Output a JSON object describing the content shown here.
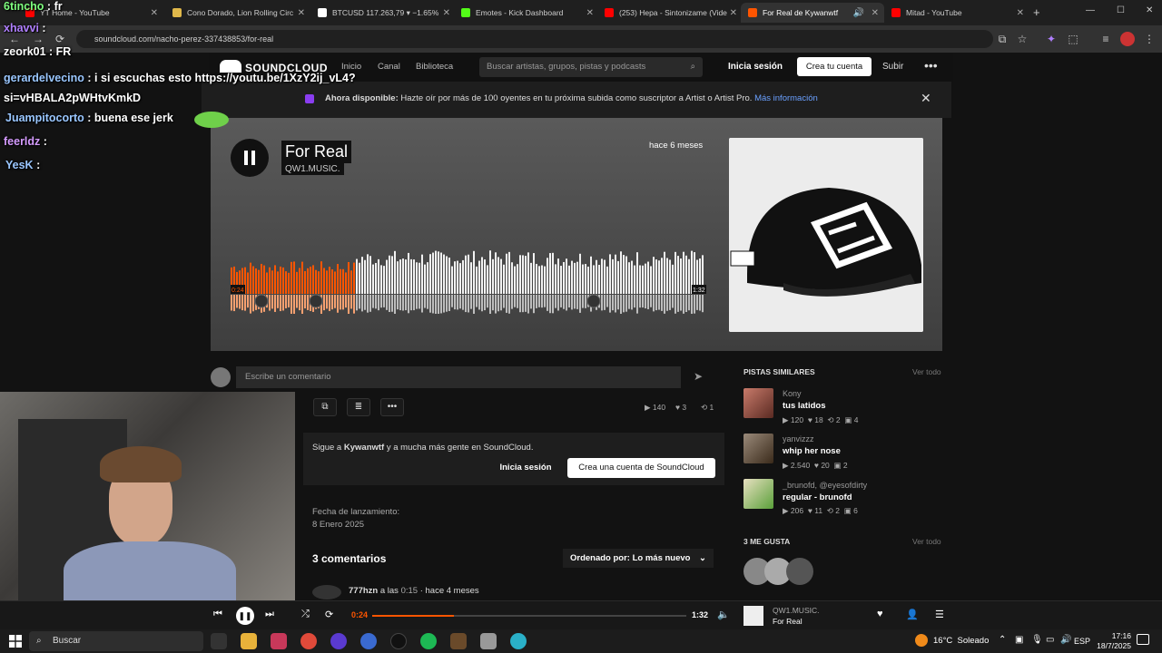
{
  "browser": {
    "tabs": [
      {
        "label": "YT Home - YouTube",
        "color": "#ff0000",
        "active": false
      },
      {
        "label": "Cono Dorado, Lion Rolling Circ",
        "color": "#e0b84a",
        "active": false
      },
      {
        "label": "BTCUSD 117.263,79 ▾ −1.65%",
        "color": "#ffffff",
        "active": false
      },
      {
        "label": "Emotes - Kick Dashboard",
        "color": "#53fc18",
        "active": false
      },
      {
        "label": "(253) Hepa - Sintonizame (Vide",
        "color": "#ff0000",
        "active": false
      },
      {
        "label": "For Real de Kywanwtf",
        "color": "#ff5500",
        "active": true
      },
      {
        "label": "Mitad - YouTube",
        "color": "#ff0000",
        "active": false
      }
    ],
    "url": "soundcloud.com/nacho-perez-337438853/for-real"
  },
  "soundcloud": {
    "logo": "SOUNDCLOUD",
    "nav": [
      "Inicio",
      "Canal",
      "Biblioteca"
    ],
    "search_placeholder": "Buscar artistas, grupos, pistas y podcasts",
    "signin": "Inicia sesión",
    "create_account": "Crea tu cuenta",
    "upload": "Subir",
    "banner_bold": "Ahora disponible:",
    "banner_text": "Hazte oír por más de 100 oyentes en tu próxima subida como suscriptor a Artist o Artist Pro.",
    "banner_link": "Más información",
    "track": {
      "title": "For Real",
      "artist": "QW1.MUSIC.",
      "posted": "hace 6 meses",
      "elapsed": "0:24",
      "duration": "1:32",
      "progress": 0.26
    },
    "comment_placeholder": "Escribe un comentario",
    "stats": {
      "plays": "140",
      "likes": "3",
      "reposts": "1"
    },
    "follow_prefix": "Sigue a",
    "follow_user": "Kywanwtf",
    "follow_suffix": "y a mucha más gente en SoundCloud.",
    "follow_signin": "Inicia sesión",
    "follow_create": "Crea una cuenta de SoundCloud",
    "release_label": "Fecha de lanzamiento:",
    "release_date": "8 Enero 2025",
    "comments_count": "3 comentarios",
    "sort_label": "Ordenado por: Lo más nuevo",
    "first_comment_user": "777hzn",
    "first_comment_at": "a las",
    "first_comment_time": "0:15",
    "first_comment_ago": "· hace 4 meses",
    "similar_title": "PISTAS SIMILARES",
    "view_all": "Ver todo",
    "similar": [
      {
        "artist": "Kony",
        "track": "tus latidos",
        "plays": "120",
        "likes": "18",
        "reposts": "2",
        "comments": "4",
        "color": "#a04a3a"
      },
      {
        "artist": "yanvizzz",
        "track": "whip her nose",
        "plays": "2.540",
        "likes": "20",
        "reposts": "",
        "comments": "2",
        "color": "#6a5a4a"
      },
      {
        "artist": "_brunofd, @eyesofdirty",
        "track": "regular - brunofd",
        "plays": "206",
        "likes": "11",
        "reposts": "2",
        "comments": "6",
        "color": "#5aa03a"
      }
    ],
    "likes_title": "3 ME GUSTA",
    "likes_view_all": "Ver todo",
    "player": {
      "elapsed": "0:24",
      "duration": "1:32",
      "artist": "QW1.MUSIC.",
      "title": "For Real"
    }
  },
  "chat": [
    {
      "user": "6tincho",
      "msg": "fr",
      "color": "#7fff7f"
    },
    {
      "user": "xhavvi",
      "msg": "",
      "color": "#b07fff"
    },
    {
      "user": "zeork01",
      "msg": "FR",
      "color": "#ffffff"
    },
    {
      "user": "gerardelvecino",
      "msg": "i si escuchas esto https://youtu.be/1XzY2ij_vL4?si=vHBALA2pWHtvKmkD",
      "color": "#9ac7ff"
    },
    {
      "user": "Juampitocorto",
      "msg": "buena ese jerk",
      "color": "#9ac7ff"
    },
    {
      "user": "feerldz",
      "msg": "",
      "color": "#d59cff"
    },
    {
      "user": "YesK",
      "msg": "",
      "color": "#9ac7ff"
    }
  ],
  "taskbar": {
    "search": "Buscar",
    "weather": "16°C  Soleado",
    "lang": "ESP",
    "time": "17:16",
    "date": "18/7/2025"
  }
}
